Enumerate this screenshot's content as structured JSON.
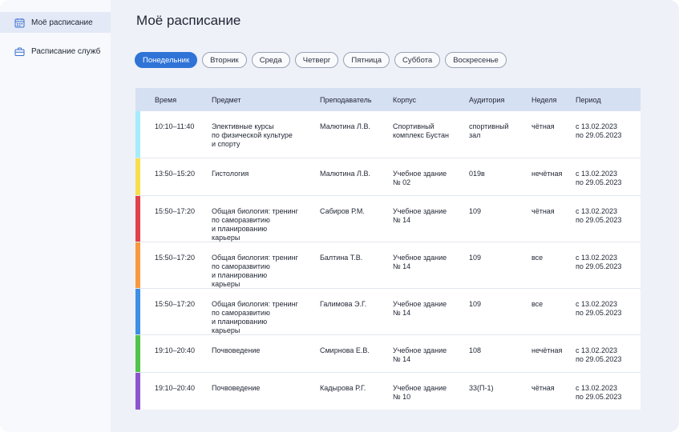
{
  "sidebar": {
    "items": [
      {
        "label": "Моё расписание",
        "icon": "calendar-icon",
        "active": true
      },
      {
        "label": "Расписание служб",
        "icon": "briefcase-icon",
        "active": false
      }
    ]
  },
  "page": {
    "title": "Моё расписание"
  },
  "days": [
    "Понедельник",
    "Вторник",
    "Среда",
    "Четверг",
    "Пятница",
    "Суббота",
    "Воскресенье"
  ],
  "active_day": "Понедельник",
  "table": {
    "headers": {
      "time": "Время",
      "subject": "Предмет",
      "teacher": "Преподаватель",
      "building": "Корпус",
      "room": "Аудитория",
      "week": "Неделя",
      "period": "Период"
    },
    "rows": [
      {
        "color": "#a6ecfb",
        "time": "10:10–11:40",
        "subject": "Элективные курсы\nпо физической культуре\nи спорту",
        "teacher": "Малютина Л.В.",
        "building": "Спортивный\nкомплекс Бустан",
        "room": "спортивный\n зал",
        "week": "чётная",
        "period": "с 13.02.2023\nпо 29.05.2023"
      },
      {
        "color": "#f8de4e",
        "time": "13:50–15:20",
        "subject": "Гистология",
        "teacher": "Малютина Л.В.",
        "building": "Учебное здание\n№ 02",
        "room": "019в",
        "week": "нечётная",
        "period": "с 13.02.2023\nпо 29.05.2023"
      },
      {
        "color": "#e0414a",
        "time": "15:50–17:20",
        "subject": "Общая биология: тренинг\nпо саморазвитию\nи планированию\nкарьеры",
        "teacher": "Сабиров Р.М.",
        "building": "Учебное здание\n№ 14",
        "room": "109",
        "week": "чётная",
        "period": "с 13.02.2023\nпо 29.05.2023"
      },
      {
        "color": "#f7993f",
        "time": "15:50–17:20",
        "subject": "Общая биология: тренинг\nпо саморазвитию\nи планированию\nкарьеры",
        "teacher": "Балтина Т.В.",
        "building": "Учебное здание\n№ 14",
        "room": "109",
        "week": "все",
        "period": "с 13.02.2023\nпо 29.05.2023"
      },
      {
        "color": "#3f8fe3",
        "time": "15:50–17:20",
        "subject": "Общая биология: тренинг\nпо саморазвитию\nи планированию\nкарьеры",
        "teacher": "Галимова Э.Г.",
        "building": "Учебное здание\n№ 14",
        "room": "109",
        "week": "все",
        "period": "с 13.02.2023\nпо 29.05.2023"
      },
      {
        "color": "#53c34b",
        "time": "19:10–20:40",
        "subject": "Почвоведение",
        "teacher": "Смирнова Е.В.",
        "building": "Учебное здание\n№ 14",
        "room": "108",
        "week": "нечётная",
        "period": "с 13.02.2023\nпо 29.05.2023"
      },
      {
        "color": "#8c55cf",
        "time": "19:10–20:40",
        "subject": "Почвоведение",
        "teacher": "Кадырова Р.Г.",
        "building": "Учебное здание\n№ 10",
        "room": "33(П-1)",
        "week": "чётная",
        "period": "с 13.02.2023\nпо 29.05.2023"
      }
    ]
  }
}
